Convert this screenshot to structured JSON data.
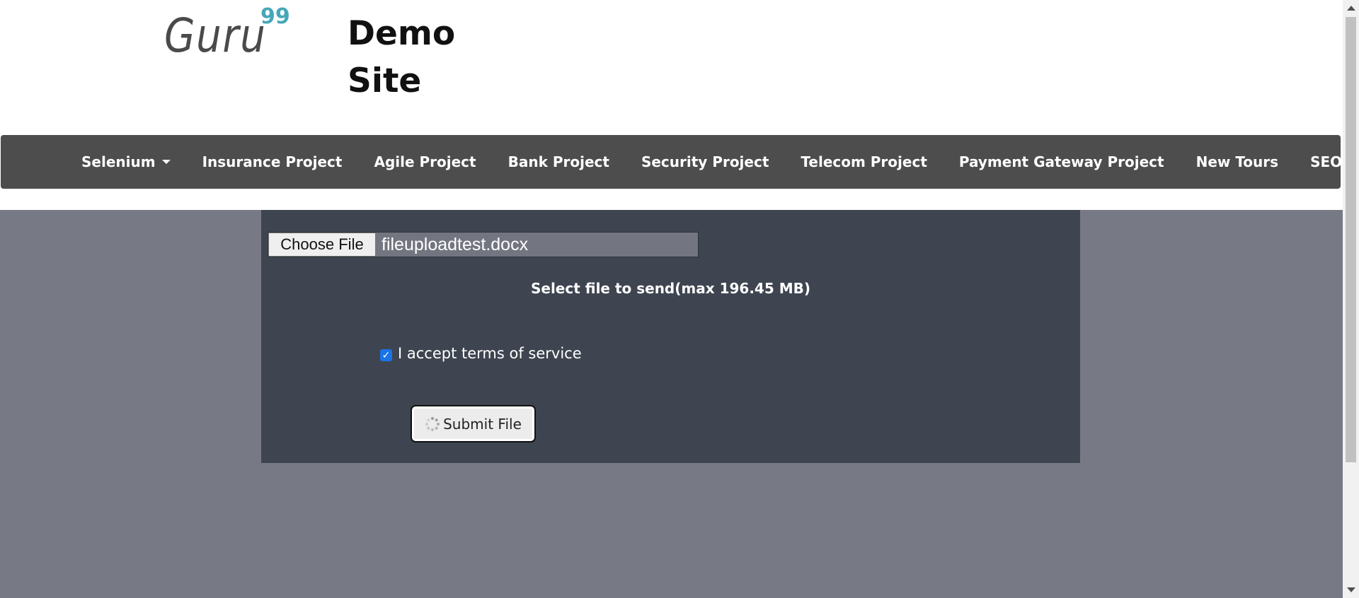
{
  "header": {
    "logo_text": "Guru",
    "logo_sup": "99",
    "title_line1": "Demo",
    "title_line2": "Site"
  },
  "nav": {
    "items": [
      {
        "label": "Selenium",
        "dropdown": true
      },
      {
        "label": "Insurance Project",
        "dropdown": false
      },
      {
        "label": "Agile Project",
        "dropdown": false
      },
      {
        "label": "Bank Project",
        "dropdown": false
      },
      {
        "label": "Security Project",
        "dropdown": false
      },
      {
        "label": "Telecom Project",
        "dropdown": false
      },
      {
        "label": "Payment Gateway Project",
        "dropdown": false
      },
      {
        "label": "New Tours",
        "dropdown": false
      },
      {
        "label": "SEO",
        "dropdown": true
      }
    ]
  },
  "upload": {
    "choose_label": "Choose File",
    "file_name": "fileuploadtest.docx",
    "hint": "Select file to send(max 196.45 MB)",
    "terms_label": "I accept terms of service",
    "terms_checked": true,
    "submit_label": "Submit File"
  },
  "colors": {
    "navbar": "#4d4d4d",
    "panel": "#3e4550",
    "page_bg": "#777a85",
    "logo_accent": "#45a8b8",
    "checkbox": "#1a73e8"
  }
}
